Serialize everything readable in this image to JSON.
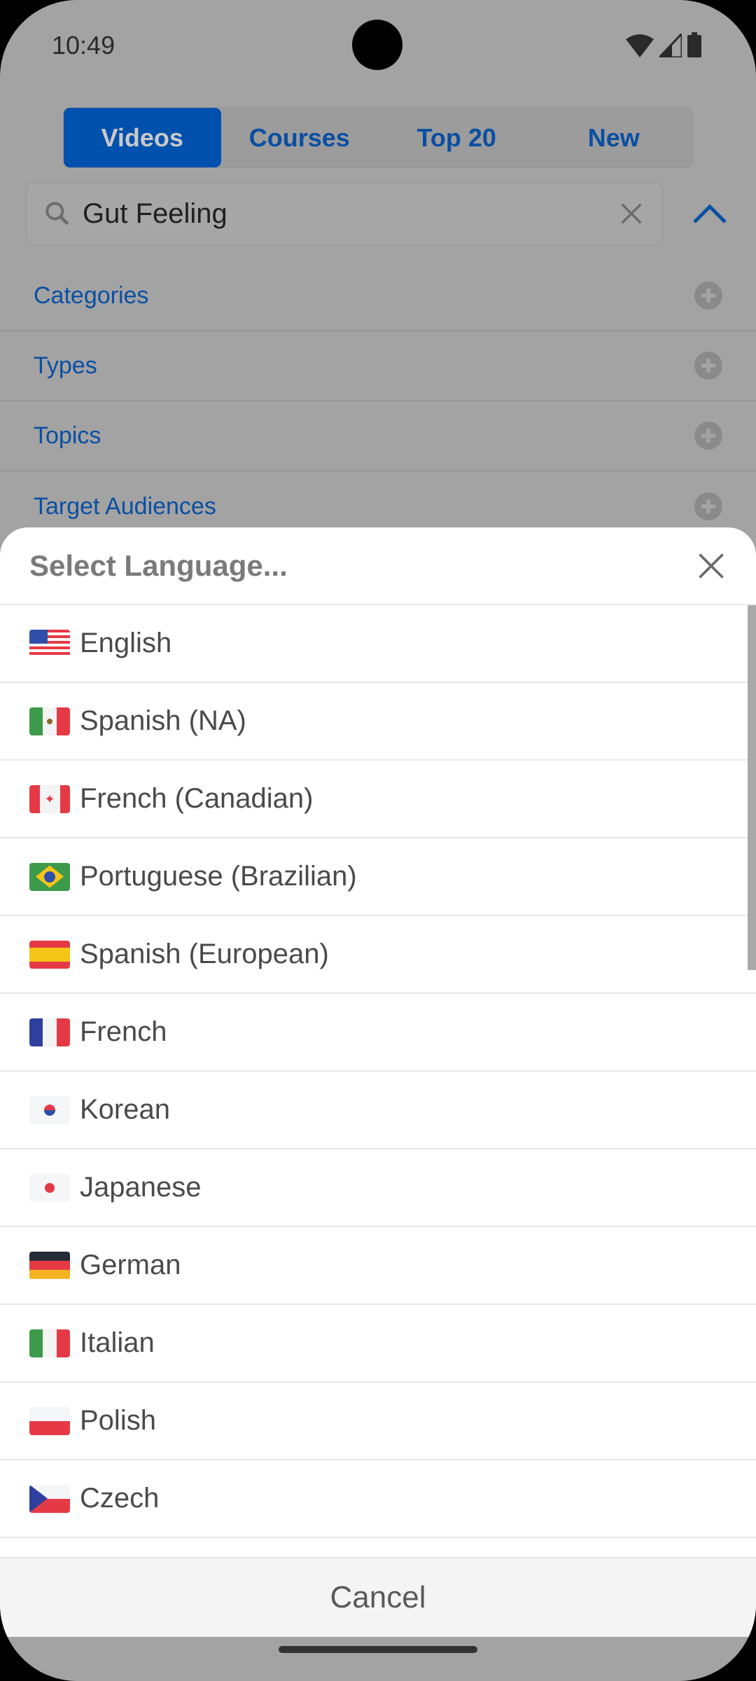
{
  "status_bar": {
    "time": "10:49",
    "icons": [
      "wifi-icon",
      "signal-icon",
      "battery-icon"
    ]
  },
  "tabs": [
    {
      "label": "Videos",
      "active": true
    },
    {
      "label": "Courses",
      "active": false
    },
    {
      "label": "Top 20",
      "active": false
    },
    {
      "label": "New",
      "active": false
    }
  ],
  "search": {
    "value": "Gut Feeling"
  },
  "filters": [
    {
      "label": "Categories"
    },
    {
      "label": "Types"
    },
    {
      "label": "Topics"
    },
    {
      "label": "Target Audiences"
    }
  ],
  "sheet": {
    "title": "Select Language...",
    "languages": [
      {
        "label": "English",
        "flag": "us"
      },
      {
        "label": "Spanish (NA)",
        "flag": "mx"
      },
      {
        "label": "French (Canadian)",
        "flag": "ca"
      },
      {
        "label": "Portuguese (Brazilian)",
        "flag": "br"
      },
      {
        "label": "Spanish (European)",
        "flag": "es"
      },
      {
        "label": "French",
        "flag": "fr"
      },
      {
        "label": "Korean",
        "flag": "kr"
      },
      {
        "label": "Japanese",
        "flag": "jp"
      },
      {
        "label": "German",
        "flag": "de"
      },
      {
        "label": "Italian",
        "flag": "it"
      },
      {
        "label": "Polish",
        "flag": "pl"
      },
      {
        "label": "Czech",
        "flag": "cz"
      }
    ],
    "cancel_label": "Cancel"
  },
  "colors": {
    "accent": "#0050ad",
    "link": "#0a4fa3",
    "overlay": "#a3a3a3"
  }
}
